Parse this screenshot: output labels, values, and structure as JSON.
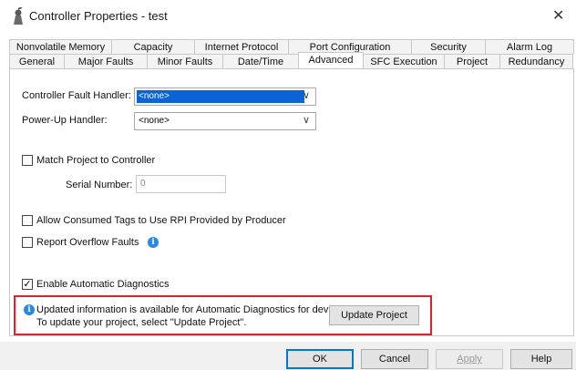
{
  "window": {
    "title": "Controller Properties - test",
    "close_glyph": "✕"
  },
  "tabs": {
    "row1": [
      "Nonvolatile Memory",
      "Capacity",
      "Internet Protocol",
      "Port Configuration",
      "Security",
      "Alarm Log"
    ],
    "row2": [
      "General",
      "Major Faults",
      "Minor Faults",
      "Date/Time",
      "Advanced",
      "SFC Execution",
      "Project",
      "Redundancy"
    ],
    "active": "Advanced"
  },
  "advanced": {
    "fault_handler_label": "Controller Fault Handler:",
    "fault_handler_value": "<none>",
    "powerup_handler_label": "Power-Up Handler:",
    "powerup_handler_value": "<none>",
    "match_project_label": "Match Project to Controller",
    "match_project_checked": false,
    "serial_number_label": "Serial Number:",
    "serial_number_value": "0",
    "allow_consumed_label": "Allow Consumed Tags to Use RPI Provided by Producer",
    "allow_consumed_checked": false,
    "report_overflow_label": "Report Overflow Faults",
    "report_overflow_checked": false,
    "enable_diag_label": "Enable Automatic Diagnostics",
    "enable_diag_checked": true,
    "check_glyph": "✓",
    "info_glyph": "i",
    "chevron_glyph": "∨",
    "diag_info_line1": "Updated information is   available for Automatic Diagnostics for devices.",
    "diag_info_line2": "To update your project, select \"Update Project\".",
    "update_project_label": "Update Project"
  },
  "footer": {
    "ok": "OK",
    "cancel": "Cancel",
    "apply": "Apply",
    "help": "Help"
  },
  "colors": {
    "highlight": "#0a64d6",
    "info": "#2a87e8",
    "annotation": "#e0202a",
    "default_button_border": "#0078d7"
  },
  "icons": {
    "title": "controller-icon",
    "close": "close-icon",
    "info": "info-icon",
    "dropdown": "chevron-down-icon",
    "check": "checkmark-icon"
  }
}
